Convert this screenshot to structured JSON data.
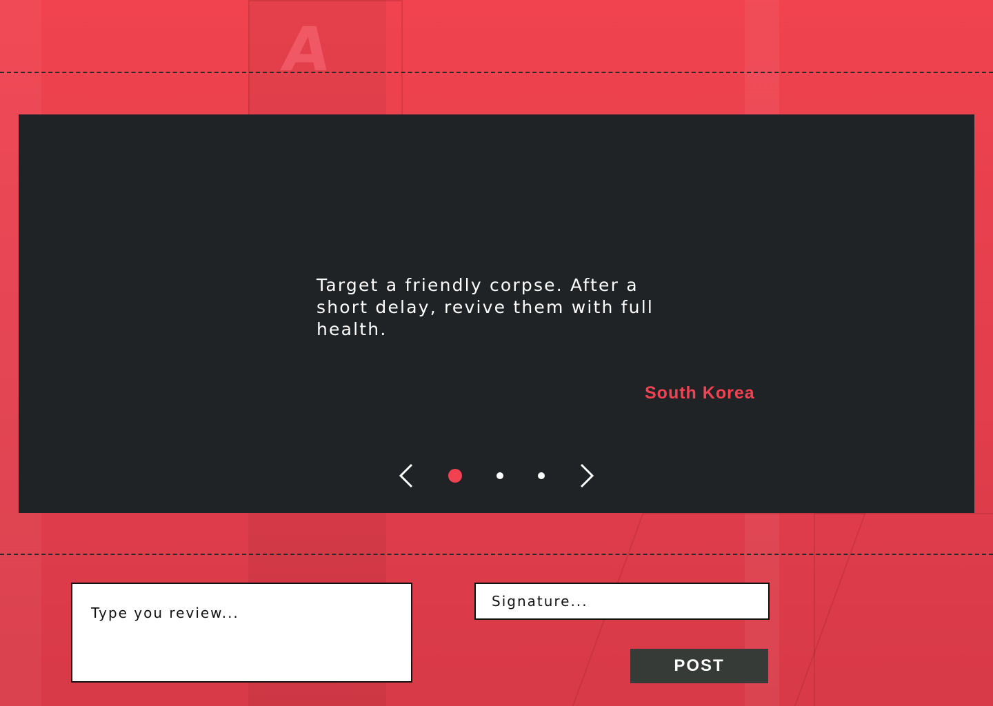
{
  "testimonial": {
    "quote": "Target a friendly corpse. After a short delay, revive them with full health.",
    "country": "South Korea"
  },
  "pager": {
    "prev_icon": "chevron-left-icon",
    "next_icon": "chevron-right-icon",
    "active_index": 0,
    "total": 3
  },
  "form": {
    "review_placeholder": "Type you review...",
    "signature_placeholder": "Signature...",
    "post_label": "POST"
  },
  "colors": {
    "accent": "#f24252",
    "card_bg": "#202326",
    "page_bg": "#e84150",
    "button_bg": "#373b37"
  }
}
